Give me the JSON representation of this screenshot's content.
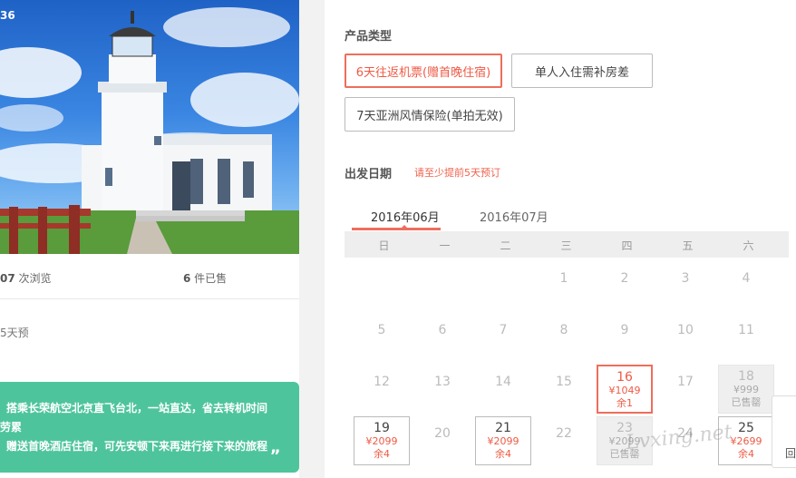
{
  "hero": {
    "badge": "36"
  },
  "stats": {
    "views_num": "07",
    "views_label": " 次浏览",
    "sold_num": "6",
    "sold_label": " 件已售"
  },
  "notice": "5天预",
  "features": {
    "line1": "搭乘长荣航空北京直飞台北，一站直达，省去转机时间",
    "line2": "劳累",
    "line3": "赠送首晚酒店住宿，可先安顿下来再进行接下来的旅程",
    "quote_mark": "„"
  },
  "product": {
    "title": "产品类型",
    "options": [
      {
        "label": "6天往返机票(赠首晚住宿)",
        "selected": true
      },
      {
        "label": "单人入住需补房差",
        "selected": false
      },
      {
        "label": "7天亚洲风情保险(单拍无效)",
        "selected": false
      }
    ]
  },
  "departure": {
    "title": "出发日期",
    "hint": "请至少提前5天预订"
  },
  "calendar": {
    "tabs": [
      "2016年06月",
      "2016年07月"
    ],
    "active_tab": 0,
    "weekdays": [
      "日",
      "一",
      "二",
      "三",
      "四",
      "五",
      "六"
    ],
    "days": [
      {
        "d": "1",
        "col": 3,
        "row": 0
      },
      {
        "d": "2",
        "col": 4,
        "row": 0
      },
      {
        "d": "3",
        "col": 5,
        "row": 0
      },
      {
        "d": "4",
        "col": 6,
        "row": 0
      },
      {
        "d": "5",
        "col": 0,
        "row": 1
      },
      {
        "d": "6",
        "col": 1,
        "row": 1
      },
      {
        "d": "7",
        "col": 2,
        "row": 1
      },
      {
        "d": "8",
        "col": 3,
        "row": 1
      },
      {
        "d": "9",
        "col": 4,
        "row": 1
      },
      {
        "d": "10",
        "col": 5,
        "row": 1
      },
      {
        "d": "11",
        "col": 6,
        "row": 1
      },
      {
        "d": "12",
        "col": 0,
        "row": 2
      },
      {
        "d": "13",
        "col": 1,
        "row": 2
      },
      {
        "d": "14",
        "col": 2,
        "row": 2
      },
      {
        "d": "15",
        "col": 3,
        "row": 2
      },
      {
        "d": "16",
        "col": 4,
        "row": 2,
        "state": "selected",
        "price": "¥1049",
        "remain": "余1"
      },
      {
        "d": "17",
        "col": 5,
        "row": 2
      },
      {
        "d": "18",
        "col": 6,
        "row": 2,
        "state": "soldout",
        "price": "¥999",
        "remain": "已售罄"
      },
      {
        "d": "19",
        "col": 0,
        "row": 3,
        "state": "available",
        "price": "¥2099",
        "remain": "余4"
      },
      {
        "d": "20",
        "col": 1,
        "row": 3
      },
      {
        "d": "21",
        "col": 2,
        "row": 3,
        "state": "available",
        "price": "¥2099",
        "remain": "余4"
      },
      {
        "d": "22",
        "col": 3,
        "row": 3
      },
      {
        "d": "23",
        "col": 4,
        "row": 3,
        "state": "soldout",
        "price": "¥2099",
        "remain": "已售罄"
      },
      {
        "d": "24",
        "col": 5,
        "row": 3
      },
      {
        "d": "25",
        "col": 6,
        "row": 3,
        "state": "available",
        "price": "¥2699",
        "remain": "余4"
      }
    ]
  },
  "float_button": {
    "label": "回"
  },
  "watermark": "Lvxing.net"
}
